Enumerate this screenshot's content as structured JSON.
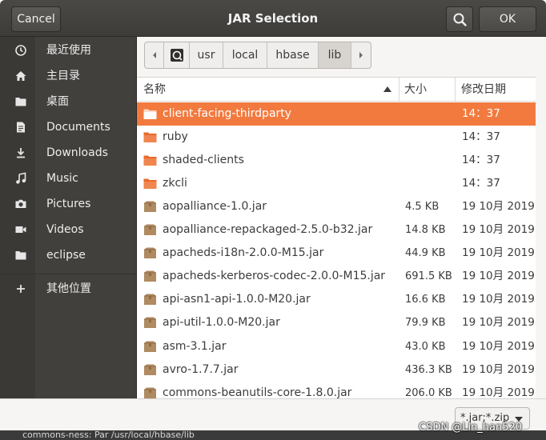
{
  "window": {
    "title": "JAR Selection",
    "cancel_label": "Cancel",
    "ok_label": "OK",
    "background_app_text": "commons-ness: Par  /usr/local/hbase/lib"
  },
  "sidebar": {
    "items": [
      {
        "label": "最近使用",
        "icon": "recent-icon"
      },
      {
        "label": "主目录",
        "icon": "home-icon"
      },
      {
        "label": "桌面",
        "icon": "folder-icon"
      },
      {
        "label": "Documents",
        "icon": "document-icon"
      },
      {
        "label": "Downloads",
        "icon": "download-icon"
      },
      {
        "label": "Music",
        "icon": "music-icon"
      },
      {
        "label": "Pictures",
        "icon": "camera-icon"
      },
      {
        "label": "Videos",
        "icon": "video-icon"
      },
      {
        "label": "eclipse",
        "icon": "folder-icon"
      },
      {
        "label": "其他位置",
        "icon": "plus-icon"
      }
    ]
  },
  "pathbar": {
    "segments": [
      "usr",
      "local",
      "hbase",
      "lib"
    ],
    "active": "lib"
  },
  "filelist": {
    "columns": {
      "name": "名称",
      "size": "大小",
      "modified": "修改日期"
    },
    "rows": [
      {
        "name": "client-facing-thirdparty",
        "size": "",
        "date": "14：37",
        "type": "folder",
        "selected": true
      },
      {
        "name": "ruby",
        "size": "",
        "date": "14：37",
        "type": "folder"
      },
      {
        "name": "shaded-clients",
        "size": "",
        "date": "14：37",
        "type": "folder"
      },
      {
        "name": "zkcli",
        "size": "",
        "date": "14：37",
        "type": "folder"
      },
      {
        "name": "aopalliance-1.0.jar",
        "size": "4.5 KB",
        "date": "19 10月 2019",
        "type": "jar"
      },
      {
        "name": "aopalliance-repackaged-2.5.0-b32.jar",
        "size": "14.8 KB",
        "date": "19 10月 2019",
        "type": "jar"
      },
      {
        "name": "apacheds-i18n-2.0.0-M15.jar",
        "size": "44.9 KB",
        "date": "19 10月 2019",
        "type": "jar"
      },
      {
        "name": "apacheds-kerberos-codec-2.0.0-M15.jar",
        "size": "691.5 KB",
        "date": "19 10月 2019",
        "type": "jar"
      },
      {
        "name": "api-asn1-api-1.0.0-M20.jar",
        "size": "16.6 KB",
        "date": "19 10月 2019",
        "type": "jar"
      },
      {
        "name": "api-util-1.0.0-M20.jar",
        "size": "79.9 KB",
        "date": "19 10月 2019",
        "type": "jar"
      },
      {
        "name": "asm-3.1.jar",
        "size": "43.0 KB",
        "date": "19 10月 2019",
        "type": "jar"
      },
      {
        "name": "avro-1.7.7.jar",
        "size": "436.3 KB",
        "date": "19 10月 2019",
        "type": "jar"
      },
      {
        "name": "commons-beanutils-core-1.8.0.jar",
        "size": "206.0 KB",
        "date": "19 10月 2019",
        "type": "jar"
      }
    ]
  },
  "footer": {
    "filter_value": "*.jar;*.zip"
  },
  "watermark": "CSDN @Lin_han520",
  "colors": {
    "header": "#3d3c39",
    "sidebar": "#41403c",
    "selection": "#f27a3f",
    "folder": "#e9692c",
    "jar": "#b08a61"
  }
}
